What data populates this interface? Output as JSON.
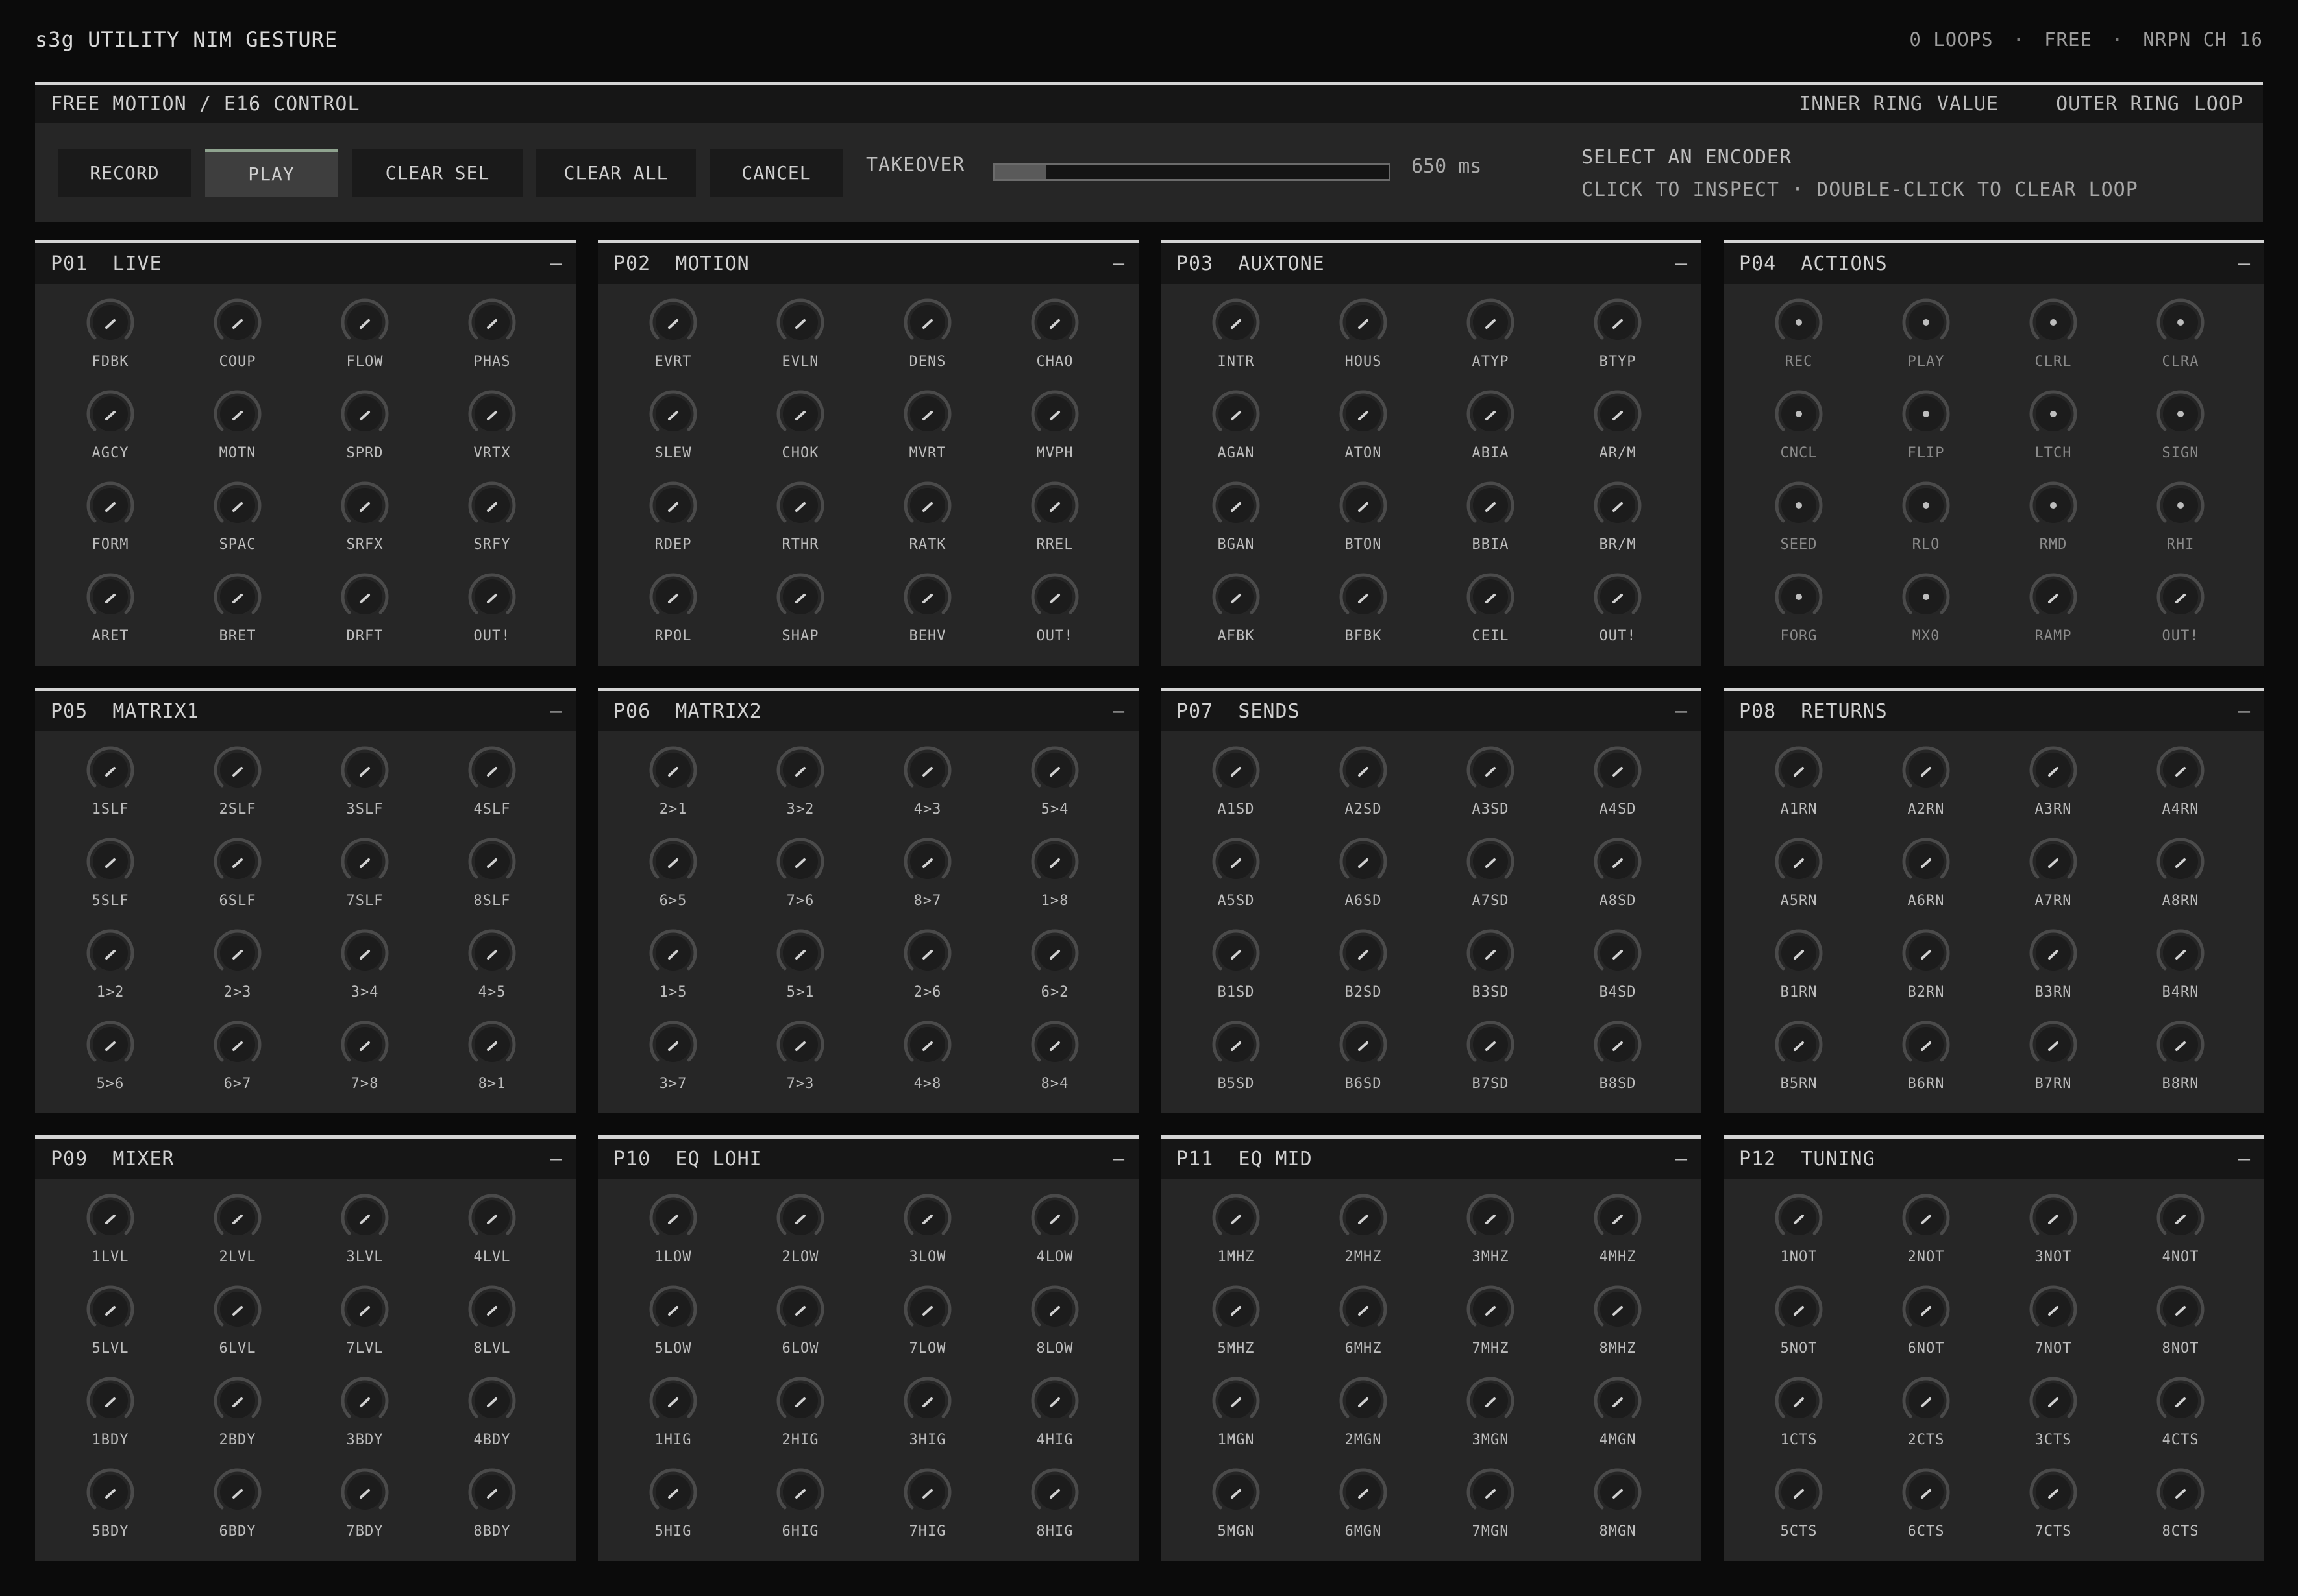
{
  "app": {
    "title": "s3g UTILITY NIM GESTURE",
    "status": {
      "loops": "0 LOOPS",
      "mode": "FREE",
      "channel": "NRPN CH 16",
      "separator": "·"
    }
  },
  "control": {
    "title": "FREE MOTION / E16 CONTROL",
    "legend": {
      "inner_label": "INNER RING",
      "inner_value": "VALUE",
      "outer_label": "OUTER RING",
      "outer_value": "LOOP"
    },
    "buttons": {
      "record": "RECORD",
      "play": "PLAY",
      "clear_sel": "CLEAR SEL",
      "clear_all": "CLEAR ALL",
      "cancel": "CANCEL"
    },
    "active_button": "play",
    "takeover": {
      "label": "TAKEOVER",
      "value_text": "650 ms",
      "fill": 0.13
    },
    "hint_line1": "SELECT AN ENCODER",
    "hint_line2": "CLICK TO INSPECT · DOUBLE-CLICK TO CLEAR LOOP"
  },
  "pages": [
    {
      "id": "P01",
      "name": "LIVE",
      "collapse": "—",
      "style": "pointer",
      "encoders": [
        "FDBK",
        "COUP",
        "FLOW",
        "PHAS",
        "AGCY",
        "MOTN",
        "SPRD",
        "VRTX",
        "FORM",
        "SPAC",
        "SRFX",
        "SRFY",
        "ARET",
        "BRET",
        "DRFT",
        "OUT!"
      ]
    },
    {
      "id": "P02",
      "name": "MOTION",
      "collapse": "—",
      "style": "pointer",
      "encoders": [
        "EVRT",
        "EVLN",
        "DENS",
        "CHAO",
        "SLEW",
        "CHOK",
        "MVRT",
        "MVPH",
        "RDEP",
        "RTHR",
        "RATK",
        "RREL",
        "RPOL",
        "SHAP",
        "BEHV",
        "OUT!"
      ]
    },
    {
      "id": "P03",
      "name": "AUXTONE",
      "collapse": "—",
      "style": "pointer",
      "encoders": [
        "INTR",
        "HOUS",
        "ATYP",
        "BTYP",
        "AGAN",
        "ATON",
        "ABIA",
        "AR/M",
        "BGAN",
        "BTON",
        "BBIA",
        "BR/M",
        "AFBK",
        "BFBK",
        "CEIL",
        "OUT!"
      ]
    },
    {
      "id": "P04",
      "name": "ACTIONS",
      "collapse": "—",
      "style": "dot",
      "encoders": [
        "REC",
        "PLAY",
        "CLRL",
        "CLRA",
        "CNCL",
        "FLIP",
        "LTCH",
        "SIGN",
        "SEED",
        "RLO",
        "RMD",
        "RHI",
        "FORG",
        "MX0",
        "RAMP",
        "OUT!"
      ]
    },
    {
      "id": "P05",
      "name": "MATRIX1",
      "collapse": "—",
      "style": "pointer",
      "encoders": [
        "1SLF",
        "2SLF",
        "3SLF",
        "4SLF",
        "5SLF",
        "6SLF",
        "7SLF",
        "8SLF",
        "1>2",
        "2>3",
        "3>4",
        "4>5",
        "5>6",
        "6>7",
        "7>8",
        "8>1"
      ]
    },
    {
      "id": "P06",
      "name": "MATRIX2",
      "collapse": "—",
      "style": "pointer",
      "encoders": [
        "2>1",
        "3>2",
        "4>3",
        "5>4",
        "6>5",
        "7>6",
        "8>7",
        "1>8",
        "1>5",
        "5>1",
        "2>6",
        "6>2",
        "3>7",
        "7>3",
        "4>8",
        "8>4"
      ]
    },
    {
      "id": "P07",
      "name": "SENDS",
      "collapse": "—",
      "style": "pointer",
      "encoders": [
        "A1SD",
        "A2SD",
        "A3SD",
        "A4SD",
        "A5SD",
        "A6SD",
        "A7SD",
        "A8SD",
        "B1SD",
        "B2SD",
        "B3SD",
        "B4SD",
        "B5SD",
        "B6SD",
        "B7SD",
        "B8SD"
      ]
    },
    {
      "id": "P08",
      "name": "RETURNS",
      "collapse": "—",
      "style": "pointer",
      "encoders": [
        "A1RN",
        "A2RN",
        "A3RN",
        "A4RN",
        "A5RN",
        "A6RN",
        "A7RN",
        "A8RN",
        "B1RN",
        "B2RN",
        "B3RN",
        "B4RN",
        "B5RN",
        "B6RN",
        "B7RN",
        "B8RN"
      ]
    },
    {
      "id": "P09",
      "name": "MIXER",
      "collapse": "—",
      "style": "pointer",
      "encoders": [
        "1LVL",
        "2LVL",
        "3LVL",
        "4LVL",
        "5LVL",
        "6LVL",
        "7LVL",
        "8LVL",
        "1BDY",
        "2BDY",
        "3BDY",
        "4BDY",
        "5BDY",
        "6BDY",
        "7BDY",
        "8BDY"
      ]
    },
    {
      "id": "P10",
      "name": "EQ LOHI",
      "collapse": "—",
      "style": "pointer",
      "encoders": [
        "1LOW",
        "2LOW",
        "3LOW",
        "4LOW",
        "5LOW",
        "6LOW",
        "7LOW",
        "8LOW",
        "1HIG",
        "2HIG",
        "3HIG",
        "4HIG",
        "5HIG",
        "6HIG",
        "7HIG",
        "8HIG"
      ]
    },
    {
      "id": "P11",
      "name": "EQ MID",
      "collapse": "—",
      "style": "pointer",
      "encoders": [
        "1MHZ",
        "2MHZ",
        "3MHZ",
        "4MHZ",
        "5MHZ",
        "6MHZ",
        "7MHZ",
        "8MHZ",
        "1MGN",
        "2MGN",
        "3MGN",
        "4MGN",
        "5MGN",
        "6MGN",
        "7MGN",
        "8MGN"
      ]
    },
    {
      "id": "P12",
      "name": "TUNING",
      "collapse": "—",
      "style": "pointer",
      "encoders": [
        "1NOT",
        "2NOT",
        "3NOT",
        "4NOT",
        "5NOT",
        "6NOT",
        "7NOT",
        "8NOT",
        "1CTS",
        "2CTS",
        "3CTS",
        "4CTS",
        "5CTS",
        "6CTS",
        "7CTS",
        "8CTS"
      ]
    }
  ],
  "colors": {
    "background": "#0b0b0b",
    "panel": "#262626",
    "panel_header": "#161616",
    "accent_rule": "#d4d4d4",
    "play_accent": "#8fa38f",
    "knob_ring": "#4a4a4a",
    "knob_body": "#1c1c1c",
    "knob_pointer": "#d0d0d0"
  }
}
